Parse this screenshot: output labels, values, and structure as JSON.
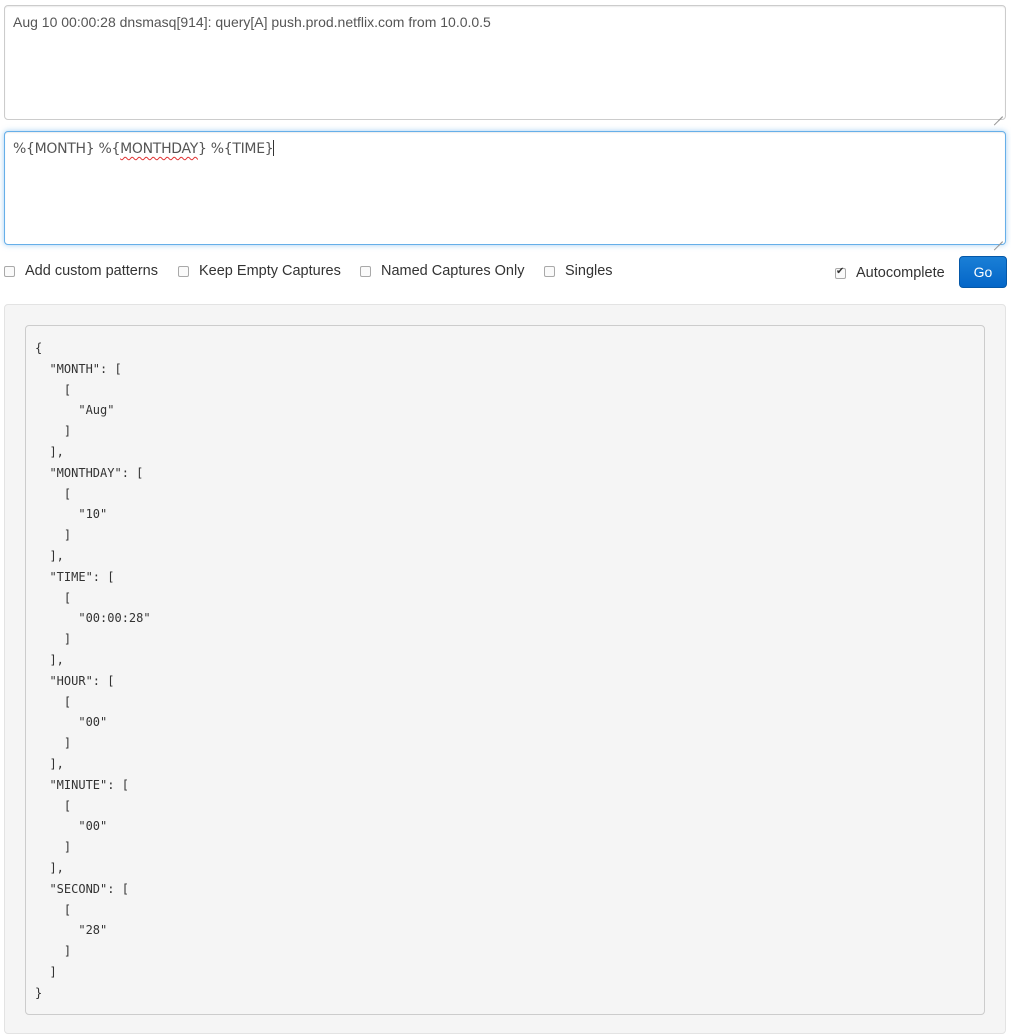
{
  "log_input": {
    "value": "Aug 10 00:00:28 dnsmasq[914]: query[A] push.prod.netflix.com from 10.0.0.5"
  },
  "pattern_input": {
    "part1": "%{MONTH} %{",
    "part2": "MONTHDAY",
    "part3": "} %{TIME}"
  },
  "options": {
    "add_custom_patterns": "Add custom patterns",
    "keep_empty_captures": "Keep Empty Captures",
    "named_captures_only": "Named Captures Only",
    "singles": "Singles",
    "autocomplete": "Autocomplete",
    "autocomplete_checked": true
  },
  "go_button": "Go",
  "result": "{\n  \"MONTH\": [\n    [\n      \"Aug\"\n    ]\n  ],\n  \"MONTHDAY\": [\n    [\n      \"10\"\n    ]\n  ],\n  \"TIME\": [\n    [\n      \"00:00:28\"\n    ]\n  ],\n  \"HOUR\": [\n    [\n      \"00\"\n    ]\n  ],\n  \"MINUTE\": [\n    [\n      \"00\"\n    ]\n  ],\n  \"SECOND\": [\n    [\n      \"28\"\n    ]\n  ]\n}"
}
